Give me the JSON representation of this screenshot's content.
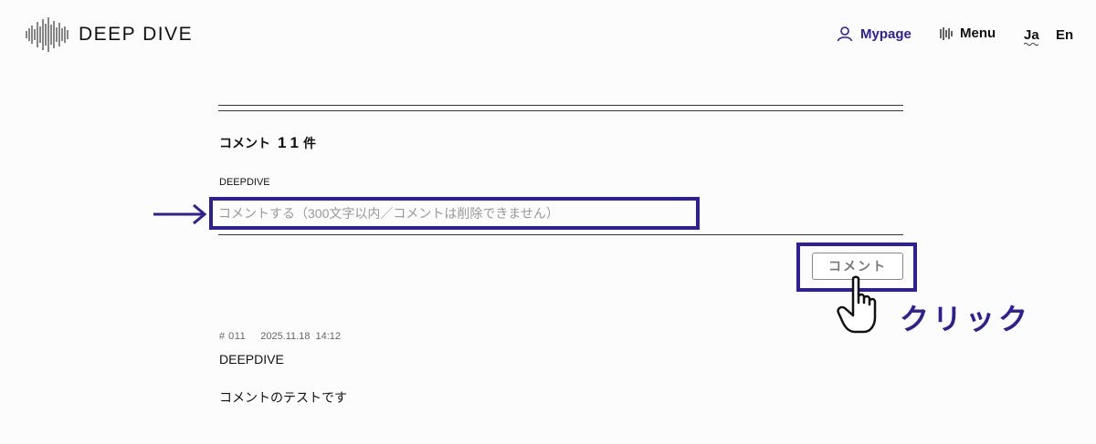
{
  "header": {
    "logo_text": "DEEP DIVE",
    "nav": {
      "mypage_label": "Mypage",
      "menu_label": "Menu",
      "lang_ja": "Ja",
      "lang_en": "En"
    }
  },
  "comments": {
    "heading": "コメント",
    "count": "11",
    "count_unit": "件",
    "user_name": "DEEPDIVE",
    "input_placeholder": "コメントする（300文字以内／コメントは削除できません）",
    "submit_label": "コメント"
  },
  "annotation": {
    "click_label": "クリック",
    "accent_color": "#2d1f96"
  },
  "posts": [
    {
      "number": "# 011",
      "date": "2025.11.18",
      "time": "14:12",
      "author": "DEEPDIVE",
      "body": "コメントのテストです"
    }
  ]
}
